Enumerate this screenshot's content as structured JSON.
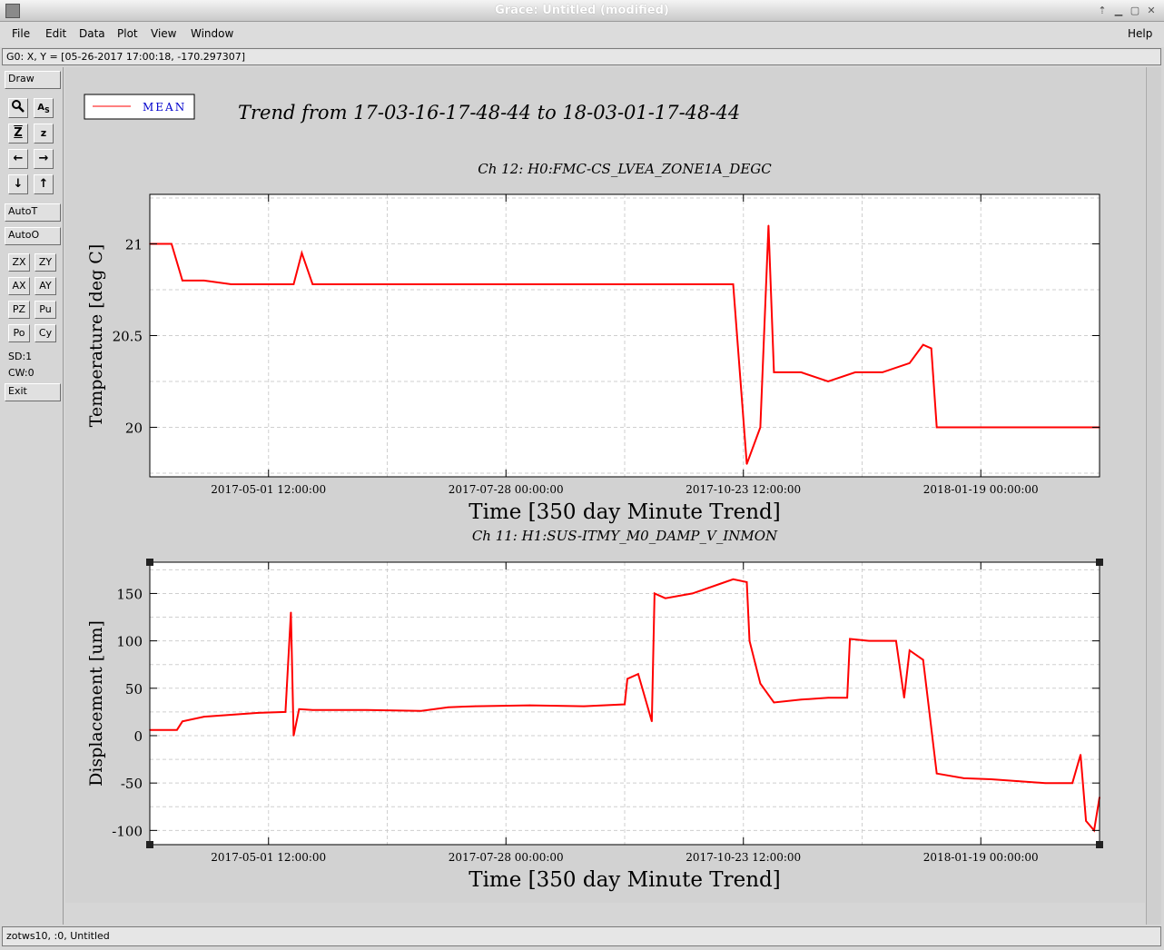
{
  "window": {
    "title": "Grace: Untitled (modified)"
  },
  "menubar": {
    "items": [
      "File",
      "Edit",
      "Data",
      "Plot",
      "View",
      "Window"
    ],
    "help": "Help"
  },
  "coord_readout": "G0: X, Y = [05-26-2017 17:00:18, -170.297307]",
  "toolbar": {
    "draw": "Draw",
    "autot": "AutoT",
    "autoo": "AutoO",
    "zx": "ZX",
    "zy": "ZY",
    "ax": "AX",
    "ay": "AY",
    "pz": "PZ",
    "pu": "Pu",
    "po": "Po",
    "cy": "Cy",
    "sd": "SD:1",
    "cw": "CW:0",
    "exit": "Exit"
  },
  "status": "zotws10, :0, Untitled",
  "graph": {
    "legend": "MEAN",
    "main_title": "Trend from 17-03-16-17-48-44 to 18-03-01-17-48-44",
    "colors": {
      "series": "#ff0000",
      "legend_text": "#0000cc"
    }
  },
  "chart_data": [
    {
      "type": "line",
      "title": "Ch 12: H0:FMC-CS_LVEA_ZONE1A_DEGC",
      "xlabel": "Time [350 day Minute Trend]",
      "ylabel": "Temperature [deg C]",
      "xticks": [
        "2017-05-01 12:00:00",
        "2017-07-28 00:00:00",
        "2017-10-23 12:00:00",
        "2018-01-19 00:00:00"
      ],
      "yticks": [
        20,
        20.5,
        21
      ],
      "ylim": [
        19.73,
        21.27
      ],
      "xlim_days": [
        0,
        350
      ],
      "grid": true,
      "series": [
        {
          "name": "MEAN",
          "x": [
            0,
            8,
            12,
            20,
            30,
            40,
            53,
            56,
            60,
            70,
            80,
            90,
            100,
            110,
            120,
            130,
            145,
            160,
            175,
            183,
            195,
            215,
            220,
            225,
            228,
            230,
            240,
            250,
            260,
            270,
            280,
            285,
            288,
            290,
            300,
            310,
            320,
            330,
            340,
            350
          ],
          "y": [
            21.0,
            21.0,
            20.8,
            20.8,
            20.78,
            20.78,
            20.78,
            20.95,
            20.78,
            20.78,
            20.78,
            20.78,
            20.78,
            20.78,
            20.78,
            20.78,
            20.78,
            20.78,
            20.78,
            20.78,
            20.78,
            20.78,
            19.8,
            20.0,
            21.1,
            20.3,
            20.3,
            20.25,
            20.3,
            20.3,
            20.35,
            20.45,
            20.43,
            20.0,
            20.0,
            20.0,
            20.0,
            20.0,
            20.0,
            20.0
          ]
        }
      ]
    },
    {
      "type": "line",
      "title": "Ch 11: H1:SUS-ITMY_M0_DAMP_V_INMON",
      "xlabel": "Time [350 day Minute Trend]",
      "ylabel": "Displacement [um]",
      "xticks": [
        "2017-05-01 12:00:00",
        "2017-07-28 00:00:00",
        "2017-10-23 12:00:00",
        "2018-01-19 00:00:00"
      ],
      "yticks": [
        -100,
        -50,
        0,
        50,
        100,
        150
      ],
      "ylim": [
        -115,
        183
      ],
      "xlim_days": [
        0,
        350
      ],
      "grid": true,
      "series": [
        {
          "name": "MEAN",
          "x": [
            0,
            10,
            12,
            20,
            30,
            40,
            50,
            52,
            53,
            55,
            60,
            80,
            100,
            110,
            120,
            140,
            160,
            175,
            176,
            180,
            185,
            186,
            190,
            200,
            210,
            215,
            220,
            221,
            225,
            230,
            240,
            250,
            257,
            258,
            265,
            275,
            278,
            280,
            285,
            290,
            300,
            310,
            320,
            330,
            335,
            340,
            343,
            345,
            348,
            350
          ],
          "y": [
            6,
            6,
            15,
            20,
            22,
            24,
            25,
            130,
            0,
            28,
            27,
            27,
            26,
            30,
            31,
            32,
            31,
            33,
            60,
            65,
            15,
            150,
            145,
            150,
            160,
            165,
            162,
            100,
            55,
            35,
            38,
            40,
            40,
            102,
            100,
            100,
            40,
            90,
            80,
            -40,
            -45,
            -46,
            -48,
            -50,
            -50,
            -50,
            -20,
            -90,
            -100,
            -65
          ]
        }
      ]
    }
  ]
}
